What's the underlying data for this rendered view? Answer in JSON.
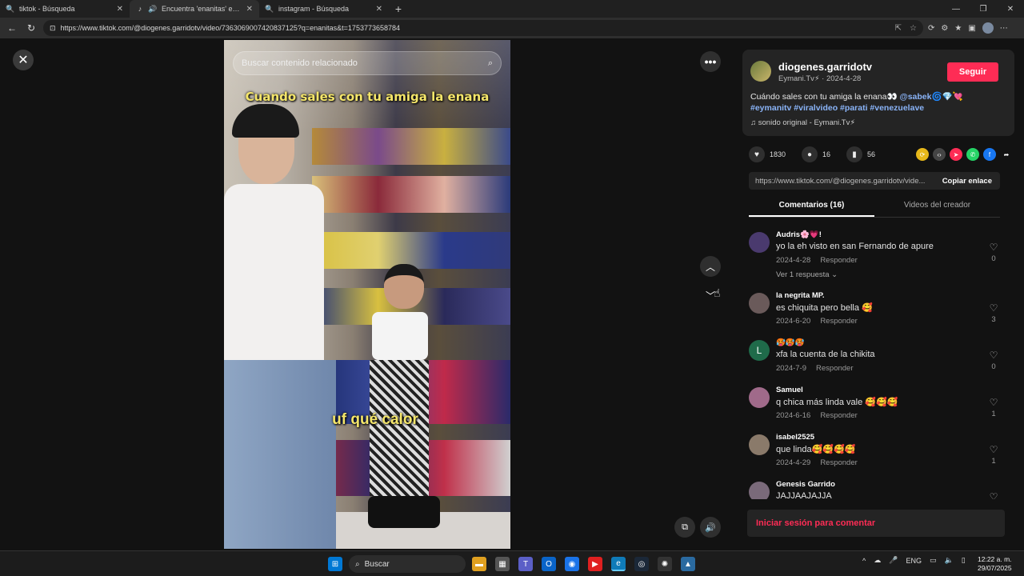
{
  "browser": {
    "tabs": [
      {
        "title": "tiktok - Búsqueda",
        "icon": "search-icon"
      },
      {
        "title": "Encuentra 'enanitas' en TikTok",
        "icon": "tiktok-icon"
      },
      {
        "title": "instagram - Búsqueda",
        "icon": "search-icon"
      }
    ],
    "url": "https://www.tiktok.com/@diogenes.garridotv/video/7363069007420837125?q=enanitas&t=1753773658784"
  },
  "video": {
    "search_placeholder": "Buscar contenido relacionado",
    "caption_top": "Cuando sales con tu amiga la enana",
    "caption_mid": "uf qué calor"
  },
  "author": {
    "username": "diogenes.garridotv",
    "subtitle": "Eymani.Tv⚡ · 2024-4-28",
    "follow_label": "Seguir",
    "description": "Cuándo sales con tu amiga la enana👀 ",
    "mention": "@sabek🌀💎💘",
    "hashtags": "#eymanitv #viralvideo #parati #venezuelave",
    "sound": "sonido original - Eymani.Tv⚡"
  },
  "actions": {
    "likes": "1830",
    "comments": "16",
    "saves": "56"
  },
  "link": {
    "url": "https://www.tiktok.com/@diogenes.garridotv/vide...",
    "copy_label": "Copiar enlace"
  },
  "tabs": {
    "comments": "Comentarios (16)",
    "creator": "Videos del creador"
  },
  "comments": [
    {
      "name": "Audris🌸💗!",
      "text": "yo la eh visto en san Fernando de apure",
      "date": "2024-4-28",
      "reply": "Responder",
      "likes": "0",
      "avatar": "#4a3a6e",
      "replies": "Ver 1 respuesta ⌄"
    },
    {
      "name": "la negrita MP.",
      "text": "es chiquita pero bella 🥰",
      "date": "2024-6-20",
      "reply": "Responder",
      "likes": "3",
      "avatar": "#6a5a5a"
    },
    {
      "name": "🥵🥵🥵",
      "text": "xfa la cuenta de la chikita",
      "date": "2024-7-9",
      "reply": "Responder",
      "likes": "0",
      "avatar": "#1f6b4a",
      "initial": "L"
    },
    {
      "name": "Samuel",
      "text": "q chica más linda vale 🥰🥰🥰",
      "date": "2024-6-16",
      "reply": "Responder",
      "likes": "1",
      "avatar": "#a06a8a"
    },
    {
      "name": "isabel2525",
      "text": "que linda🥰🥰🥰🥰",
      "date": "2024-4-29",
      "reply": "Responder",
      "likes": "1",
      "avatar": "#8a7a6a"
    },
    {
      "name": "Genesis Garrido",
      "text": "JAJJAAJAJJA",
      "date": "",
      "reply": "",
      "likes": "",
      "avatar": "#7a6a7a"
    }
  ],
  "login_prompt": "Iniciar sesión para comentar",
  "taskbar": {
    "search": "Buscar",
    "lang": "ENG",
    "time": "12:22 a. m.",
    "date": "29/07/2025"
  }
}
